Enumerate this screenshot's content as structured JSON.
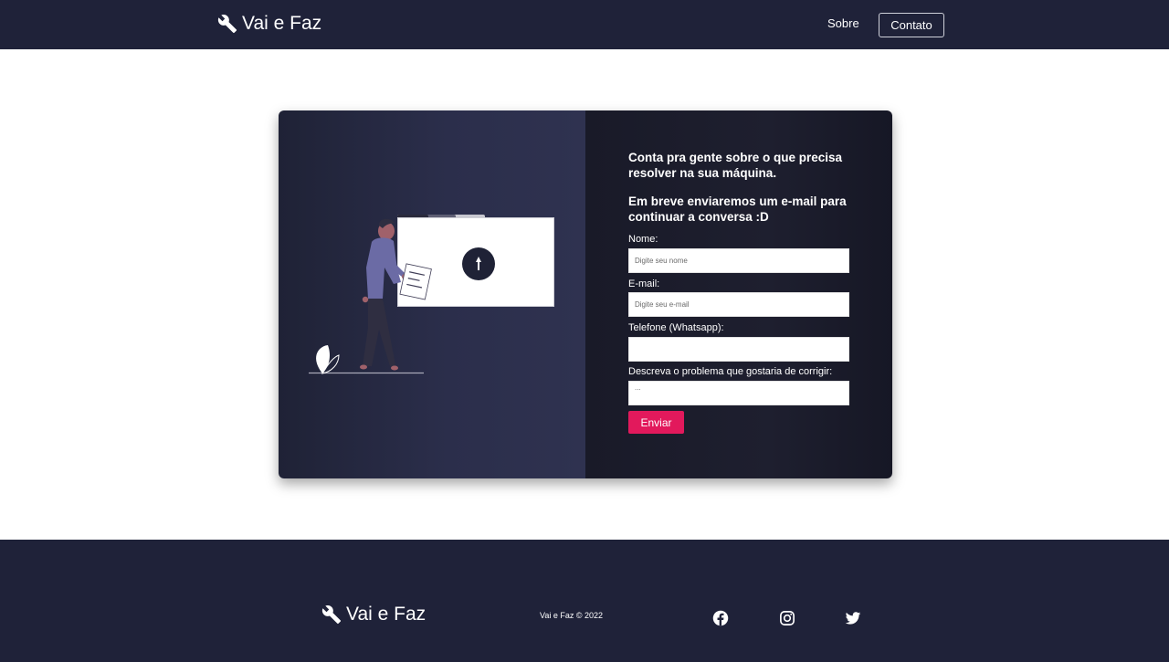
{
  "header": {
    "brand": "Vai e Faz",
    "nav": {
      "sobre": "Sobre",
      "contato": "Contato"
    }
  },
  "form": {
    "heading_1": "Conta pra gente sobre o que precisa resolver na sua máquina.",
    "heading_2": "Em breve enviaremos um e-mail para continuar a conversa :D",
    "name_label": "Nome:",
    "name_placeholder": "Digite seu nome",
    "email_label": "E-mail:",
    "email_placeholder": "Digite seu e-mail",
    "phone_label": "Telefone (Whatsapp):",
    "phone_placeholder": "",
    "problem_label": "Descreva o problema que gostaria de corrigir:",
    "problem_placeholder": "...",
    "submit_label": "Enviar"
  },
  "footer": {
    "brand": "Vai e Faz",
    "copyright": "Vai e Faz © 2022",
    "social": [
      "facebook-icon",
      "instagram-icon",
      "twitter-icon"
    ]
  },
  "colors": {
    "nav_bg": "#1f2239",
    "accent": "#e2195c",
    "figure_shirt": "#6c63ff"
  }
}
